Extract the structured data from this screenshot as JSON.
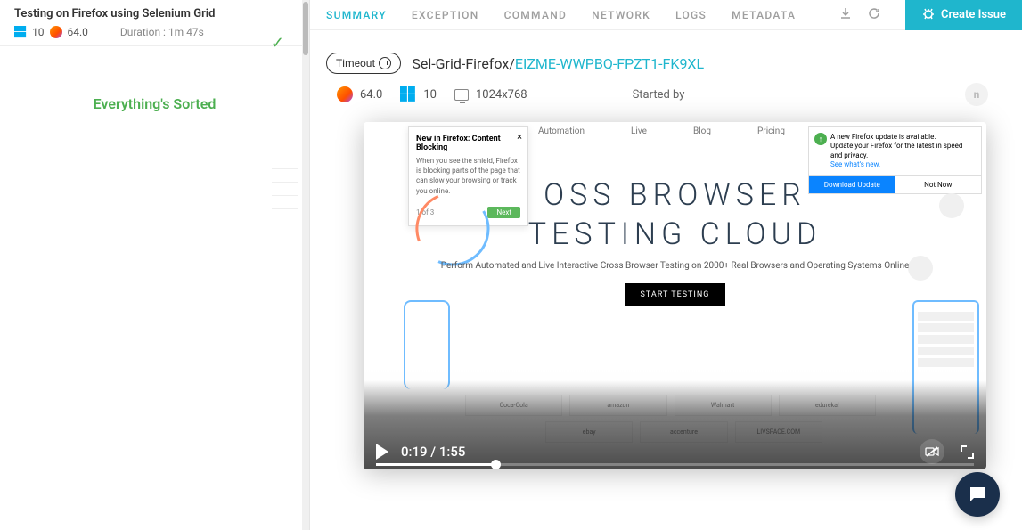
{
  "sidebar": {
    "title": "Testing on Firefox using Selenium Grid",
    "os_version": "10",
    "browser_version": "64.0",
    "duration_label": "Duration : 1m 47s",
    "sorted_message": "Everything's Sorted"
  },
  "tabs": [
    "SUMMARY",
    "EXCEPTION",
    "COMMAND",
    "NETWORK",
    "LOGS",
    "METADATA"
  ],
  "active_tab": 0,
  "create_issue_label": "Create Issue",
  "session": {
    "status_label": "Timeout",
    "name_prefix": "Sel-Grid-Firefox/",
    "id": "EIZME-WWPBQ-FPZT1-FK9XL",
    "browser_version": "64.0",
    "os_version": "10",
    "resolution": "1024x768",
    "started_by_label": "Started by",
    "user_initial": "n"
  },
  "video": {
    "current_time": "0:19",
    "total_time": "1:55",
    "progress_pct": 20,
    "hero_title_1": "OSS BROWSER",
    "hero_title_2": "TESTING CLOUD",
    "hero_sub": "Perform Automated and Live Interactive Cross Browser Testing on 2000+ Real Browsers and Operating Systems Online",
    "cta": "START TESTING",
    "nav": [
      "Automation",
      "Live",
      "Blog",
      "Pricing"
    ],
    "brands1": [
      "Coca-Cola",
      "amazon",
      "Walmart",
      "edureka!"
    ],
    "brands2": [
      "ebay",
      "accenture",
      "LIVSPACE.COM"
    ],
    "fx_popup": {
      "title": "New in Firefox: Content Blocking",
      "body": "When you see the shield, Firefox is blocking parts of the page that can slow your browsing or track you online.",
      "step": "1 of 3",
      "next": "Next"
    },
    "fx_update": {
      "line1": "A new Firefox update is available.",
      "line2": "Update your Firefox for the latest in speed and privacy.",
      "link": "See what's new.",
      "download": "Download Update",
      "not_now": "Not Now"
    }
  }
}
